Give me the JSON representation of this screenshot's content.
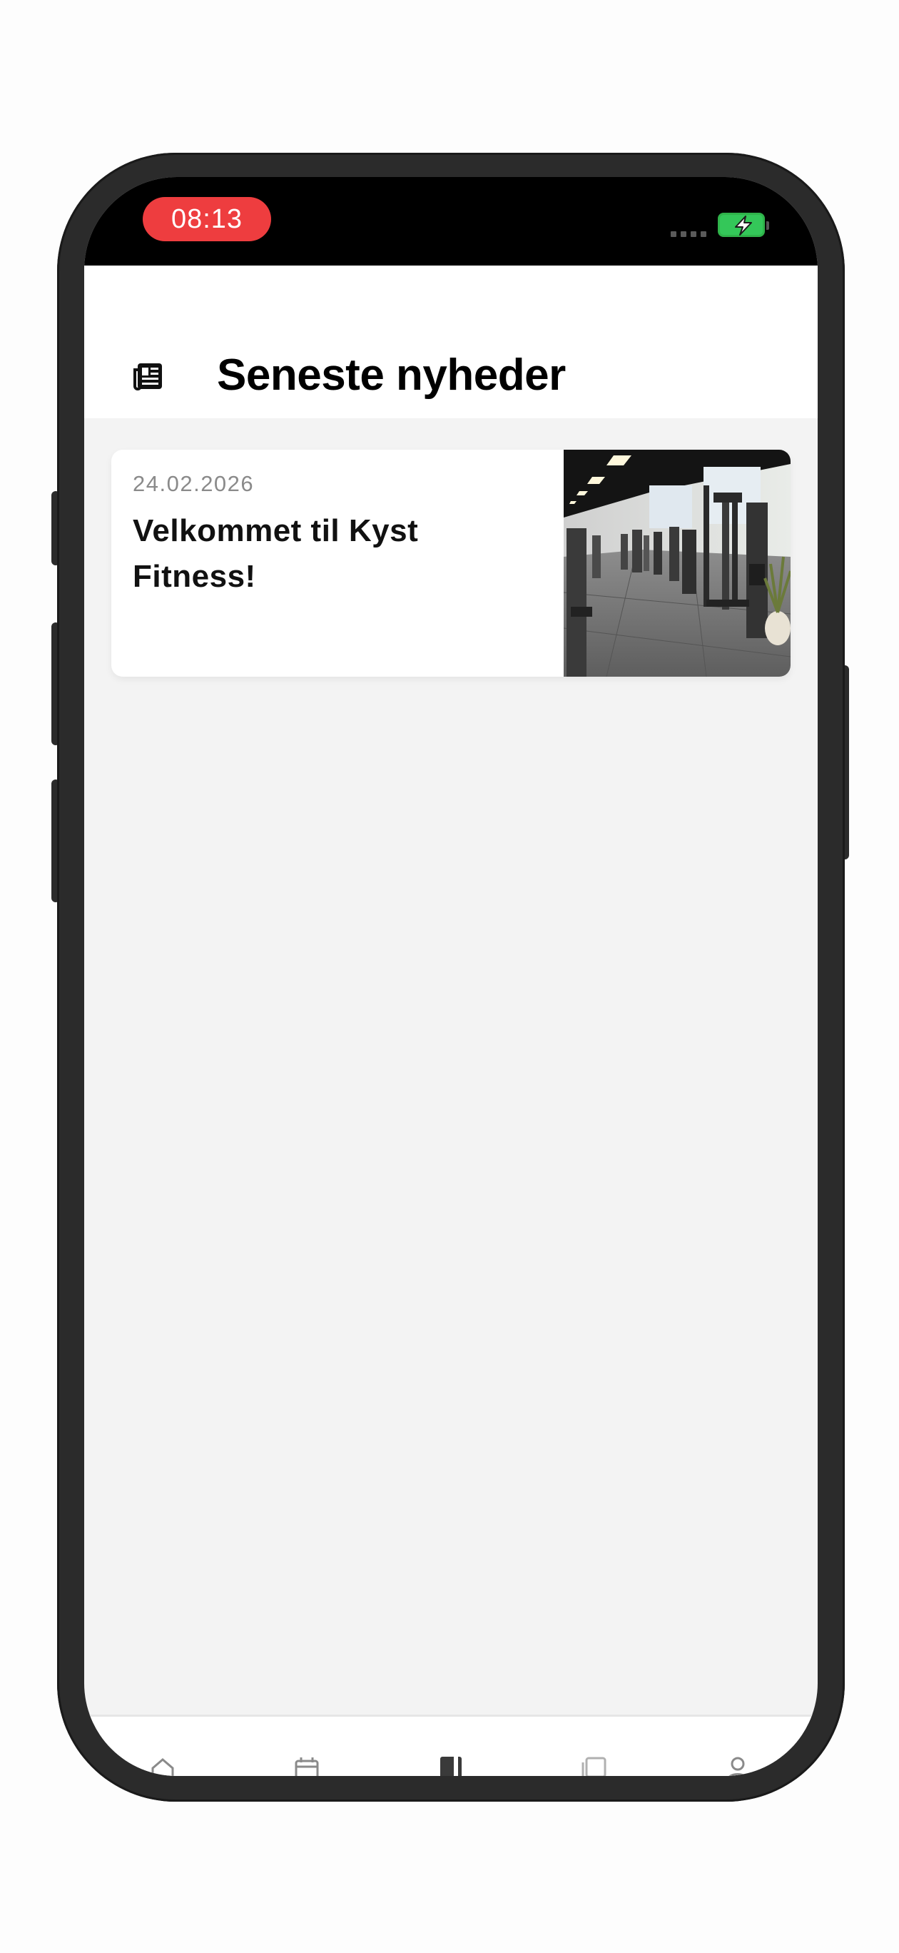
{
  "status_bar": {
    "time": "08:13",
    "time_pill_color": "#ee3d3f",
    "battery_icon": "battery-charging-icon",
    "battery_color": "#34c759"
  },
  "header": {
    "icon": "newspaper-icon",
    "title": "Seneste nyheder"
  },
  "news": [
    {
      "date": "24.02.2026",
      "title": "Velkommet til Kyst Fitness!",
      "image": "gym-interior-photo"
    }
  ],
  "bottom_nav": {
    "items": [
      {
        "icon": "home-icon"
      },
      {
        "icon": "calendar-icon"
      },
      {
        "icon": "book-icon",
        "active": true
      },
      {
        "icon": "gallery-icon"
      },
      {
        "icon": "profile-icon"
      }
    ]
  }
}
